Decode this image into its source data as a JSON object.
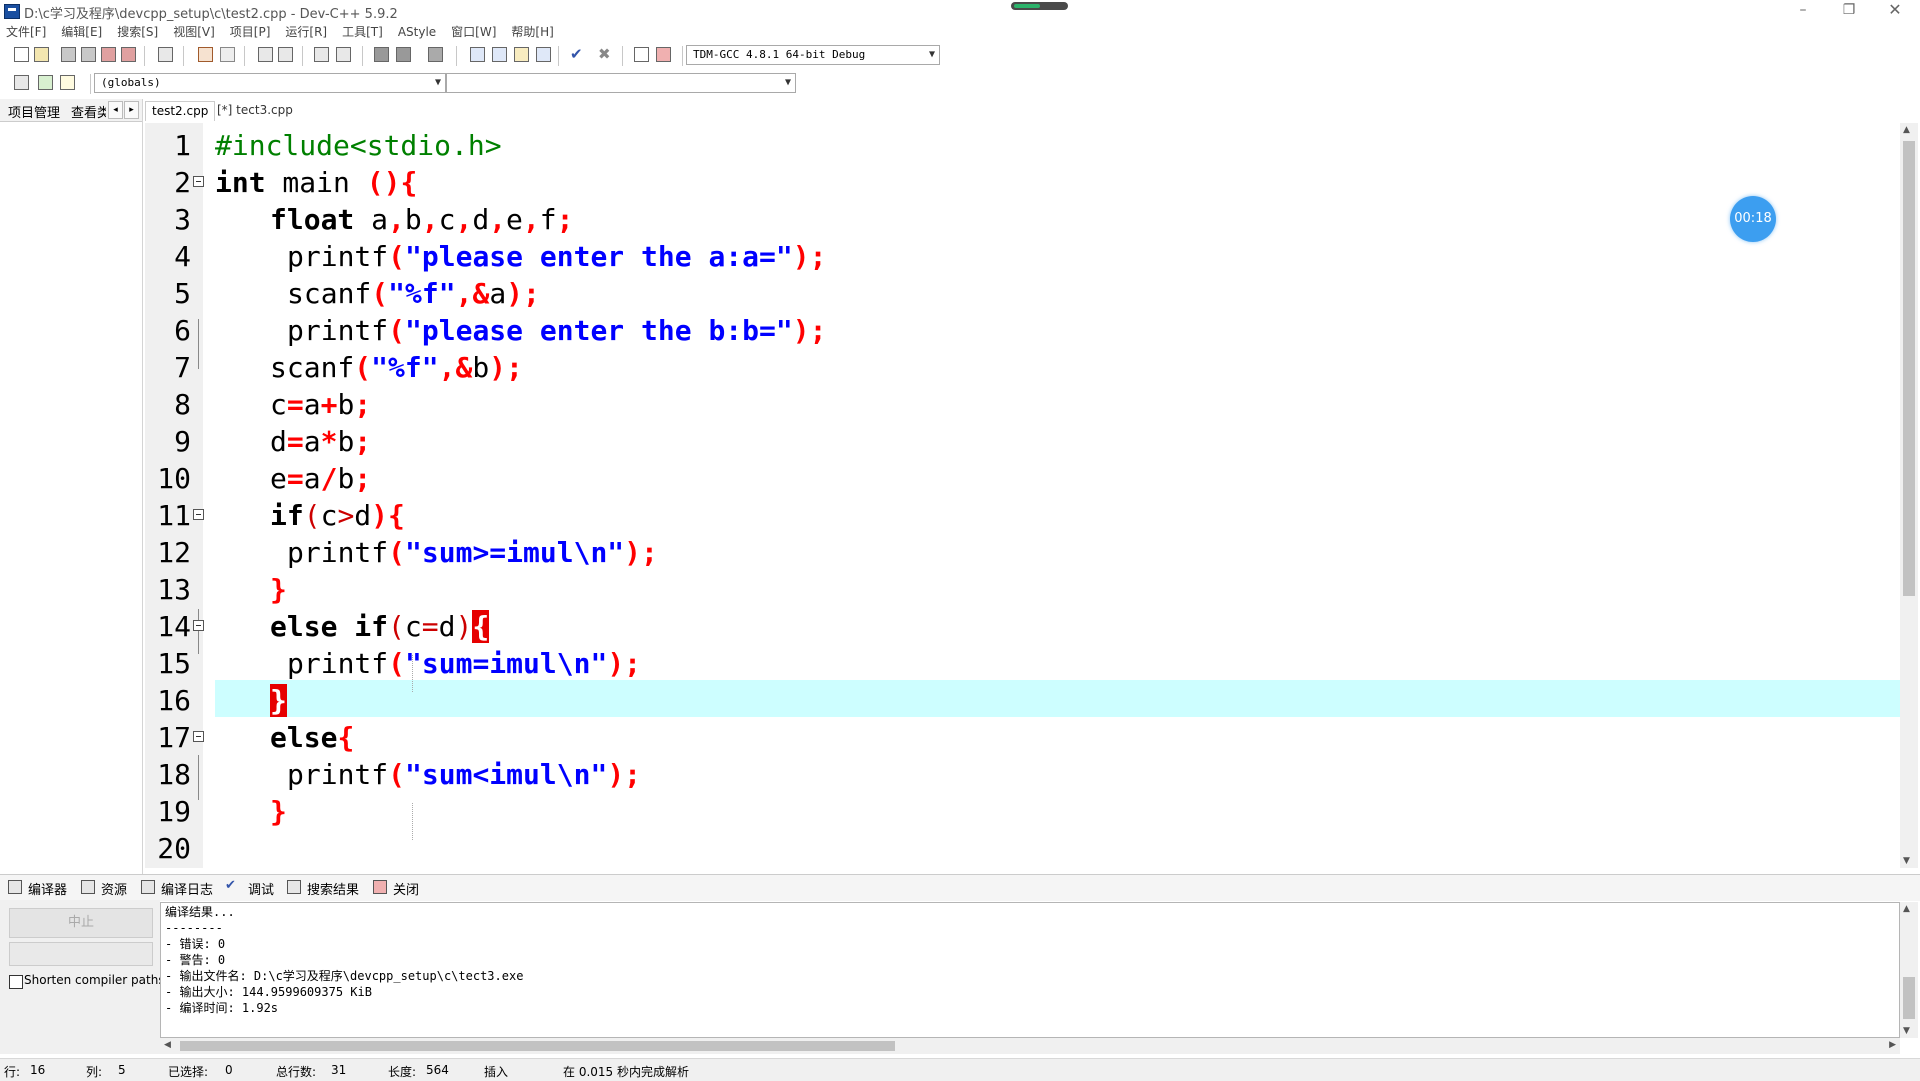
{
  "window": {
    "title": "D:\\c学习及程序\\devcpp_setup\\c\\test2.cpp - Dev-C++ 5.9.2",
    "min_icon": "–",
    "max_icon": "❐",
    "close_icon": "✕"
  },
  "menu": [
    "文件[F]",
    "编辑[E]",
    "搜索[S]",
    "视图[V]",
    "项目[P]",
    "运行[R]",
    "工具[T]",
    "AStyle",
    "窗口[W]",
    "帮助[H]"
  ],
  "toolbar": {
    "compiler": "TDM-GCC 4.8.1 64-bit Debug",
    "scope": "(globals)",
    "symbol": ""
  },
  "left_panel": {
    "tab1": "项目管理",
    "tab2": "查看类",
    "arrow_left": "◂",
    "arrow_right": "▸"
  },
  "editor_tabs": [
    "test2.cpp",
    "[*] tect3.cpp"
  ],
  "code": {
    "lines": [
      "1",
      "2",
      "3",
      "4",
      "5",
      "6",
      "7",
      "8",
      "9",
      "10",
      "11",
      "12",
      "13",
      "14",
      "15",
      "16",
      "17",
      "18",
      "19",
      "20"
    ],
    "current_line": 16
  },
  "timer": "00:18",
  "bottom_tabs": [
    "编译器",
    "资源",
    "编译日志",
    "调试",
    "搜索结果",
    "关闭"
  ],
  "bottom_left": {
    "abort": "中止",
    "shorten": "Shorten compiler paths"
  },
  "log": [
    "编译结果...",
    "--------",
    "- 错误: 0",
    "- 警告: 0",
    "- 输出文件名: D:\\c学习及程序\\devcpp_setup\\c\\tect3.exe",
    "- 输出大小: 144.9599609375 KiB",
    "- 编译时间: 1.92s"
  ],
  "status": {
    "row_label": "行:",
    "row": "16",
    "col_label": "列:",
    "col": "5",
    "sel_label": "已选择:",
    "sel": "0",
    "total_label": "总行数:",
    "total": "31",
    "len_label": "长度:",
    "len": "564",
    "mode": "插入",
    "parse": "在 0.015 秒内完成解析"
  }
}
